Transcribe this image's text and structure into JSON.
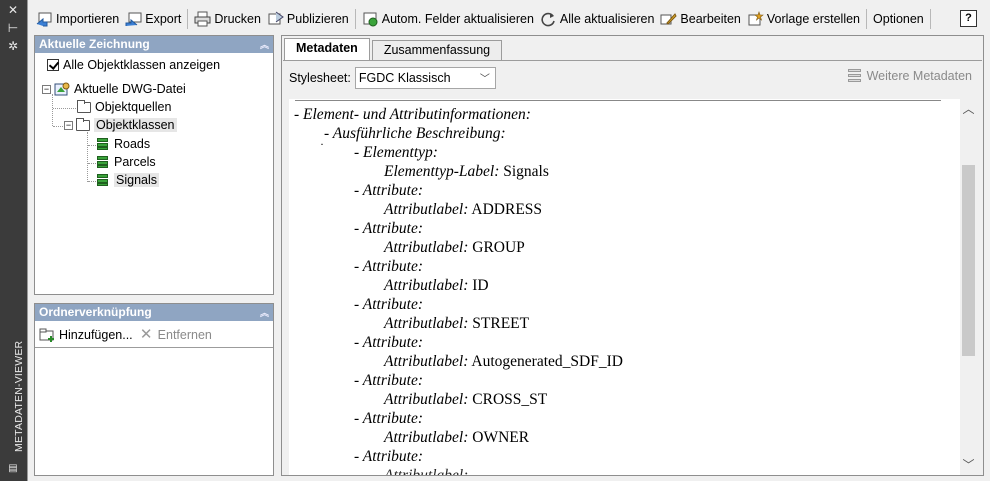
{
  "strip": {
    "title": "METADATEN-VIEWER",
    "icons": [
      "close-icon",
      "pin-icon",
      "settings-icon",
      "menu-icon"
    ]
  },
  "toolbar": {
    "import": "Importieren",
    "export": "Export",
    "print": "Drucken",
    "publish": "Publizieren",
    "update_fields": "Autom. Felder aktualisieren",
    "update_all": "Alle aktualisieren",
    "edit": "Bearbeiten",
    "create_template": "Vorlage erstellen",
    "options": "Optionen",
    "help": "?"
  },
  "current_drawing": {
    "header": "Aktuelle Zeichnung",
    "show_all_label": "Alle Objektklassen anzeigen",
    "show_all_checked": true,
    "tree": {
      "root": "Aktuelle DWG-Datei",
      "sources": "Objektquellen",
      "classes": "Objektklassen",
      "layers": [
        "Roads",
        "Parcels",
        "Signals"
      ],
      "selected": "Signals"
    }
  },
  "folder_link": {
    "header": "Ordnerverknüpfung",
    "add": "Hinzufügen...",
    "remove": "Entfernen"
  },
  "main": {
    "tabs": [
      "Metadaten",
      "Zusammenfassung"
    ],
    "active_tab": "Metadaten",
    "stylesheet_label": "Stylesheet:",
    "stylesheet_value": "FGDC Klassisch",
    "more_metadata": "Weitere Metadaten"
  },
  "document": {
    "entity_info": "- Element- und Attributinformationen:",
    "detailed_desc": "- Ausführliche Beschreibung:",
    "dot": "·",
    "entity_type": "- Elementtyp:",
    "entity_type_label": "Elementtyp-Label:",
    "entity_type_value": "Signals",
    "attribute_heading": "- Attribute:",
    "attribute_label": "Attributlabel:",
    "attributes": [
      "ADDRESS",
      "GROUP",
      "ID",
      "STREET",
      "Autogenerated_SDF_ID",
      "CROSS_ST",
      "OWNER"
    ]
  }
}
